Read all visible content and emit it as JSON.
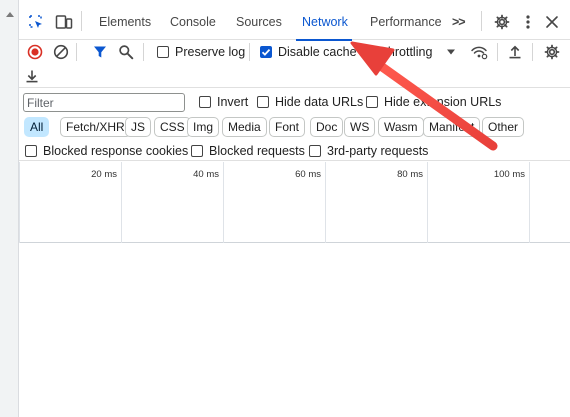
{
  "colors": {
    "accent": "#0b57d0",
    "record_red": "#d93025",
    "annotation_arrow": "#e8403a",
    "active_chip_bg": "#c2e7ff"
  },
  "tabbar": {
    "icons": [
      "inspect-element-icon",
      "device-toolbar-icon",
      "more-tabs-icon",
      "settings-icon",
      "kebab-menu-icon",
      "close-icon"
    ],
    "tabs": [
      {
        "label": "Elements",
        "active": false
      },
      {
        "label": "Console",
        "active": false
      },
      {
        "label": "Sources",
        "active": false
      },
      {
        "label": "Network",
        "active": true
      },
      {
        "label": "Performance",
        "active": false
      }
    ],
    "overflow_label": ">>"
  },
  "toolbar": {
    "icons": [
      "record-icon",
      "clear-icon",
      "filter-icon",
      "search-icon",
      "network-conditions-icon",
      "import-icon",
      "network-settings-icon",
      "export-icon"
    ],
    "preserve_log": {
      "label": "Preserve log",
      "checked": false
    },
    "disable_cache": {
      "label": "Disable cache",
      "checked": true
    },
    "throttling": {
      "label": "No throttling"
    }
  },
  "filter": {
    "placeholder": "Filter",
    "value": "",
    "invert": {
      "label": "Invert",
      "checked": false
    },
    "hide_data_urls": {
      "label": "Hide data URLs",
      "checked": false
    },
    "hide_extension_urls": {
      "label": "Hide extension URLs",
      "checked": false
    }
  },
  "chips": [
    {
      "label": "All",
      "active": true
    },
    {
      "label": "Fetch/XHR",
      "active": false
    },
    {
      "label": "JS",
      "active": false
    },
    {
      "label": "CSS",
      "active": false
    },
    {
      "label": "Img",
      "active": false
    },
    {
      "label": "Media",
      "active": false
    },
    {
      "label": "Font",
      "active": false
    },
    {
      "label": "Doc",
      "active": false
    },
    {
      "label": "WS",
      "active": false
    },
    {
      "label": "Wasm",
      "active": false
    },
    {
      "label": "Manifest",
      "active": false
    },
    {
      "label": "Other",
      "active": false
    }
  ],
  "blocked": {
    "blocked_cookies": {
      "label": "Blocked response cookies",
      "checked": false
    },
    "blocked_requests": {
      "label": "Blocked requests",
      "checked": false
    },
    "third_party": {
      "label": "3rd-party requests",
      "checked": false
    }
  },
  "overview": {
    "ticks": [
      "20 ms",
      "40 ms",
      "60 ms",
      "80 ms",
      "100 ms"
    ]
  }
}
